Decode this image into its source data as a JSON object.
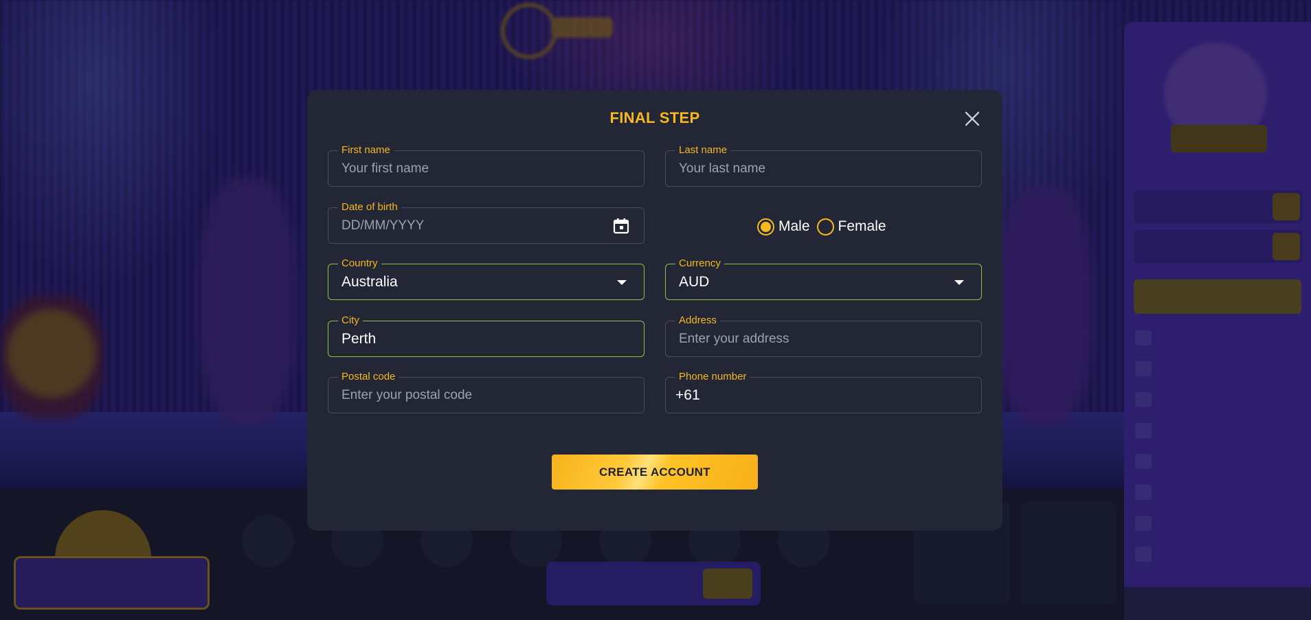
{
  "modal": {
    "title": "FINAL STEP",
    "close_icon": "close-icon"
  },
  "form": {
    "first_name": {
      "label": "First name",
      "placeholder": "Your first name",
      "value": ""
    },
    "last_name": {
      "label": "Last name",
      "placeholder": "Your last name",
      "value": ""
    },
    "date_of_birth": {
      "label": "Date of birth",
      "placeholder": "DD/MM/YYYY",
      "icon": "calendar-icon"
    },
    "gender": {
      "options": [
        "Male",
        "Female"
      ],
      "selected": "Male"
    },
    "country": {
      "label": "Country",
      "value": "Australia"
    },
    "currency": {
      "label": "Currency",
      "value": "AUD"
    },
    "city": {
      "label": "City",
      "value": "Perth"
    },
    "address": {
      "label": "Address",
      "placeholder": "Enter your address",
      "value": ""
    },
    "postal_code": {
      "label": "Postal code",
      "placeholder": "Enter your postal code",
      "value": ""
    },
    "phone": {
      "label": "Phone number",
      "value": "+61"
    },
    "submit_label": "CREATE ACCOUNT"
  },
  "colors": {
    "accent": "#f8b81f",
    "active_border": "#8bc34a",
    "modal_bg": "#232634",
    "field_border": "#474c5e"
  }
}
